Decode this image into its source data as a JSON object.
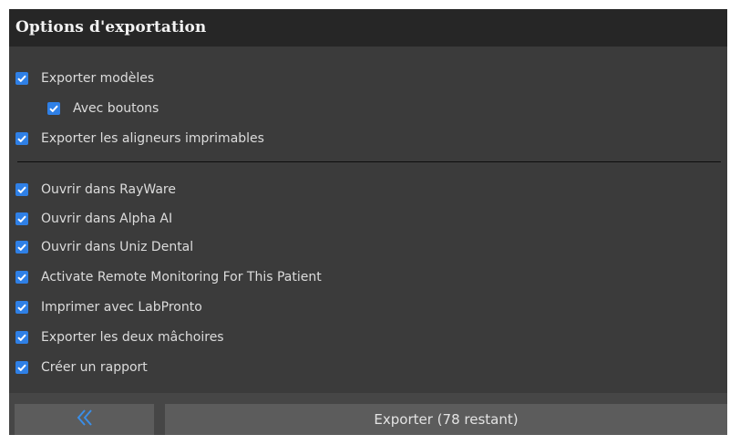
{
  "header": {
    "title": "Options d'exportation"
  },
  "options": [
    {
      "label": "Exporter modèles",
      "checked": true
    },
    {
      "label": "Avec boutons",
      "checked": true
    },
    {
      "label": "Exporter les aligneurs imprimables",
      "checked": true
    },
    {
      "label": "Ouvrir dans RayWare",
      "checked": true
    },
    {
      "label": "Ouvrir dans Alpha AI",
      "checked": true
    },
    {
      "label": "Ouvrir dans Uniz Dental",
      "checked": true
    },
    {
      "label": "Activate Remote Monitoring For This Patient",
      "checked": true
    },
    {
      "label": "Imprimer avec LabPronto",
      "checked": true
    },
    {
      "label": "Exporter les deux mâchoires",
      "checked": true
    },
    {
      "label": "Créer un rapport",
      "checked": true
    }
  ],
  "footer": {
    "back_icon": "double-chevron-left-icon",
    "export_label": "Exporter (78 restant)"
  },
  "colors": {
    "accent": "#2f80e6",
    "panel_bg": "#3b3b3b",
    "header_bg": "#262626",
    "button_bg": "#5c5c5c"
  }
}
